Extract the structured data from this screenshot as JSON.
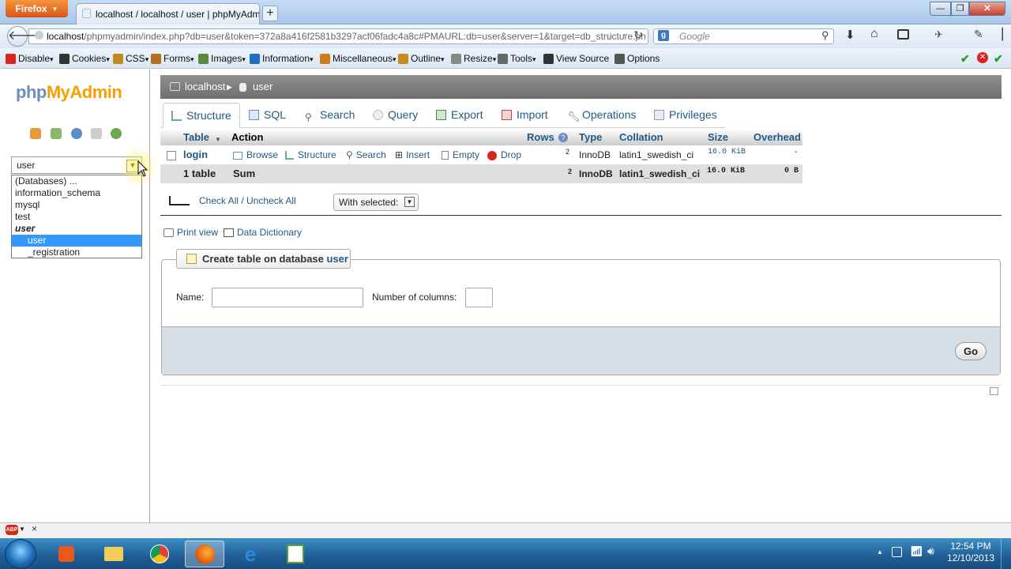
{
  "browser": {
    "app_button": "Firefox",
    "tab_title": "localhost / localhost / user | phpMyAdm...",
    "url_host": "localhost",
    "url_rest": "/phpmyadmin/index.php?db=user&token=372a8a416f2581b3297acf06fadc4a8c#PMAURL:db=user&server=1&target=db_structure.ph",
    "search_placeholder": "Google"
  },
  "webdev_toolbar": [
    {
      "label": "Disable",
      "color": "#d9261c"
    },
    {
      "label": "Cookies",
      "color": "#333333"
    },
    {
      "label": "CSS",
      "color": "#c28a1a"
    },
    {
      "label": "Forms",
      "color": "#b07020"
    },
    {
      "label": "Images",
      "color": "#5a8a3a"
    },
    {
      "label": "Information",
      "color": "#1f6fc0"
    },
    {
      "label": "Miscellaneous",
      "color": "#d07a1a"
    },
    {
      "label": "Outline",
      "color": "#c98a20"
    },
    {
      "label": "Resize",
      "color": "#888888"
    },
    {
      "label": "Tools",
      "color": "#666666"
    },
    {
      "label": "View Source",
      "color": "#333333"
    },
    {
      "label": "Options",
      "color": "#555555"
    }
  ],
  "sidebar": {
    "logo_part1": "php",
    "logo_part2": "MyAdmin",
    "db_select_value": "user",
    "db_list": [
      "(Databases) ...",
      "information_schema",
      "mysql",
      "test",
      "user",
      "user",
      "_registration"
    ]
  },
  "breadcrumb": {
    "server": "localhost",
    "database": "user"
  },
  "tabs": [
    "Structure",
    "SQL",
    "Search",
    "Query",
    "Export",
    "Import",
    "Operations",
    "Privileges"
  ],
  "table": {
    "headers": {
      "table": "Table",
      "action": "Action",
      "rows": "Rows",
      "type": "Type",
      "collation": "Collation",
      "size": "Size",
      "overhead": "Overhead"
    },
    "actions": [
      "Browse",
      "Structure",
      "Search",
      "Insert",
      "Empty",
      "Drop"
    ],
    "rows": [
      {
        "name": "login",
        "rows": "2",
        "type": "InnoDB",
        "collation": "latin1_swedish_ci",
        "size": "16.0 KiB",
        "overhead": "-"
      }
    ],
    "summary": {
      "name": "1 table",
      "action": "Sum",
      "rows": "2",
      "type": "InnoDB",
      "collation": "latin1_swedish_ci",
      "size": "16.0 KiB",
      "overhead": "0 B"
    }
  },
  "controls": {
    "check_all": "Check All / Uncheck All",
    "with_selected": "With selected:"
  },
  "links": {
    "print_view": "Print view",
    "data_dictionary": "Data Dictionary"
  },
  "create_table": {
    "legend_prefix": "Create table on database ",
    "legend_db": "user",
    "name_label": "Name:",
    "columns_label": "Number of columns:",
    "go": "Go"
  },
  "taskbar": {
    "time": "12:54 PM",
    "date": "12/10/2013"
  },
  "colors": {
    "pma_blue": "#235a81",
    "accent_orange": "#f4a100",
    "selection": "#3399ff"
  }
}
